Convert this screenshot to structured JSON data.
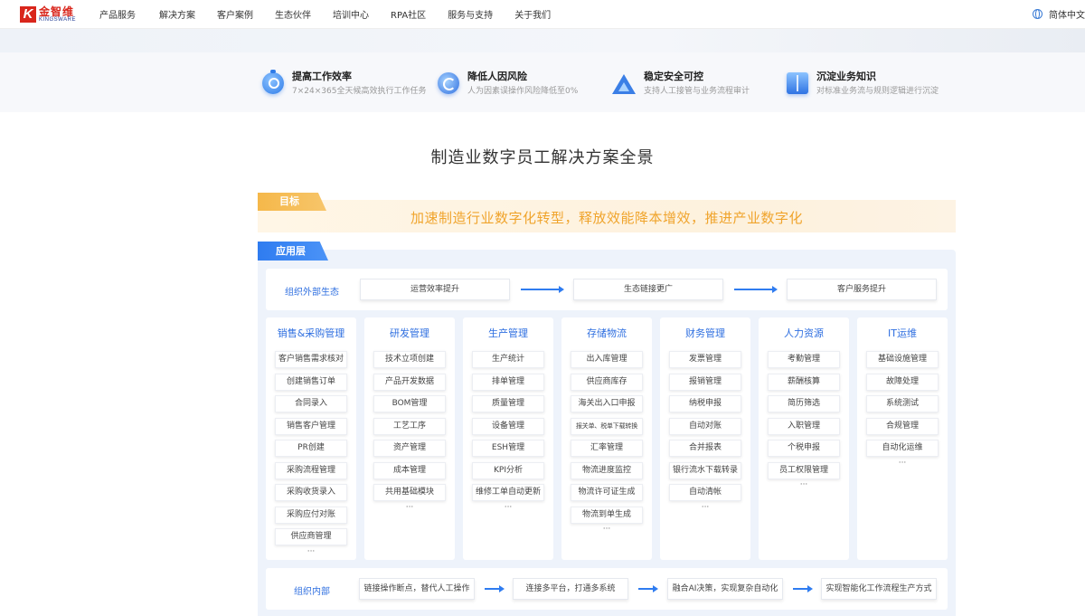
{
  "nav": {
    "logo_cn": "金智维",
    "logo_en": "KINGSWARE",
    "items": [
      "产品服务",
      "解决方案",
      "客户案例",
      "生态伙伴",
      "培训中心",
      "RPA社区",
      "服务与支持",
      "关于我们"
    ],
    "language": "简体中文"
  },
  "features": [
    {
      "icon": "stopwatch-icon",
      "title": "提高工作效率",
      "desc": "7×24×365全天候高效执行工作任务"
    },
    {
      "icon": "swirl-icon",
      "title": "降低人因风险",
      "desc": "人为因素误操作风险降低至0%"
    },
    {
      "icon": "mountain-icon",
      "title": "稳定安全可控",
      "desc": "支持人工接管与业务流程审计"
    },
    {
      "icon": "book-icon",
      "title": "沉淀业务知识",
      "desc": "对标准业务流与规则逻辑进行沉淀"
    }
  ],
  "main_title": "制造业数字员工解决方案全景",
  "goal": {
    "tag": "目标",
    "text": "加速制造行业数字化转型，释放效能降本增效，推进产业数字化"
  },
  "app_layer": {
    "tag": "应用层",
    "external": {
      "label": "组织外部生态",
      "steps": [
        "运营效率提升",
        "生态链接更广",
        "客户服务提升"
      ]
    },
    "columns": [
      {
        "title": "销售&采购管理",
        "items": [
          "客户销售需求核对",
          "创建销售订单",
          "合同录入",
          "销售客户管理",
          "PR创建",
          "采购流程管理",
          "采购收货录入",
          "采购应付对账",
          "供应商管理"
        ],
        "more": "···"
      },
      {
        "title": "研发管理",
        "items": [
          "技术立项创建",
          "产品开发数据",
          "BOM管理",
          "工艺工序",
          "资产管理",
          "成本管理",
          "共用基础模块"
        ],
        "more": "···"
      },
      {
        "title": "生产管理",
        "items": [
          "生产统计",
          "排单管理",
          "质量管理",
          "设备管理",
          "ESH管理",
          "KPI分析",
          "维修工单自动更新"
        ],
        "more": "···"
      },
      {
        "title": "存储物流",
        "items": [
          "出入库管理",
          "供应商库存",
          "海关出入口申报",
          "报关单、税单下载转换",
          "汇率管理",
          "物流进度监控",
          "物流许可证生成",
          "物流到单生成"
        ],
        "more": "···"
      },
      {
        "title": "财务管理",
        "items": [
          "发票管理",
          "报销管理",
          "纳税申报",
          "自动对账",
          "合并报表",
          "银行流水下载转录",
          "自动清帐"
        ],
        "more": "···"
      },
      {
        "title": "人力资源",
        "items": [
          "考勤管理",
          "薪酬核算",
          "简历筛选",
          "入职管理",
          "个税申报",
          "员工权限管理"
        ],
        "more": "···"
      },
      {
        "title": "IT运维",
        "items": [
          "基础设施管理",
          "故障处理",
          "系统测试",
          "合规管理",
          "自动化运维"
        ],
        "more": "···"
      }
    ],
    "internal": {
      "label": "组织内部",
      "steps": [
        "链接操作断点，替代人工操作",
        "连接多平台，打通多系统",
        "融合AI决策，实现复杂自动化",
        "实现智能化工作流程生产方式"
      ]
    }
  }
}
